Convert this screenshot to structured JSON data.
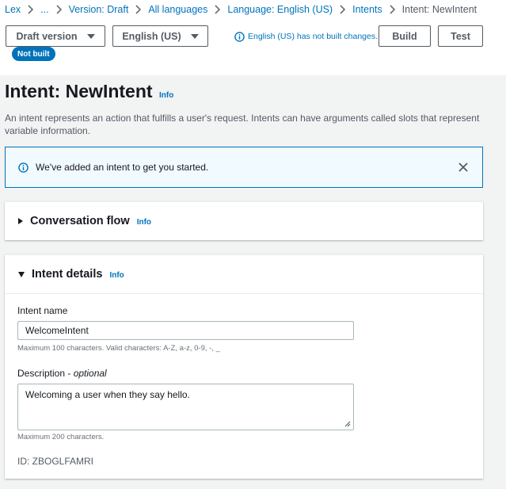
{
  "breadcrumb": {
    "items": [
      "Lex",
      "...",
      "Version: Draft",
      "All languages",
      "Language: English (US)",
      "Intents"
    ],
    "current": "Intent: NewIntent"
  },
  "toolbar": {
    "version_dropdown": "Draft version",
    "language_dropdown": "English (US)",
    "build_status": "English (US) has not built changes.",
    "build_button": "Build",
    "test_button": "Test",
    "badge": "Not built"
  },
  "page": {
    "title": "Intent: NewIntent",
    "info": "Info",
    "description": "An intent represents an action that fulfills a user's request. Intents can have arguments called slots that represent variable information."
  },
  "flash": {
    "message": "We've added an intent to get you started."
  },
  "conversation_flow": {
    "title": "Conversation flow",
    "info": "Info"
  },
  "intent_details": {
    "title": "Intent details",
    "info": "Info",
    "name_label": "Intent name",
    "name_value": "WelcomeIntent",
    "name_hint": "Maximum 100 characters. Valid characters: A-Z, a-z, 0-9, -, _",
    "description_label": "Description - ",
    "description_optional": "optional",
    "description_value": "Welcoming a user when they say hello.",
    "description_hint": "Maximum 200 characters.",
    "id": "ID: ZBOGLFAMRI"
  },
  "colors": {
    "link": "#0073bb",
    "badge_bg": "#0073bb",
    "flash_bg": "#f1faff",
    "page_bg": "#f2f3f3"
  },
  "icons": [
    "chevron-right-icon",
    "caret-down-icon",
    "info-circle-icon",
    "close-icon",
    "expand-triangle-icon",
    "collapse-triangle-icon",
    "resize-grip-icon"
  ]
}
